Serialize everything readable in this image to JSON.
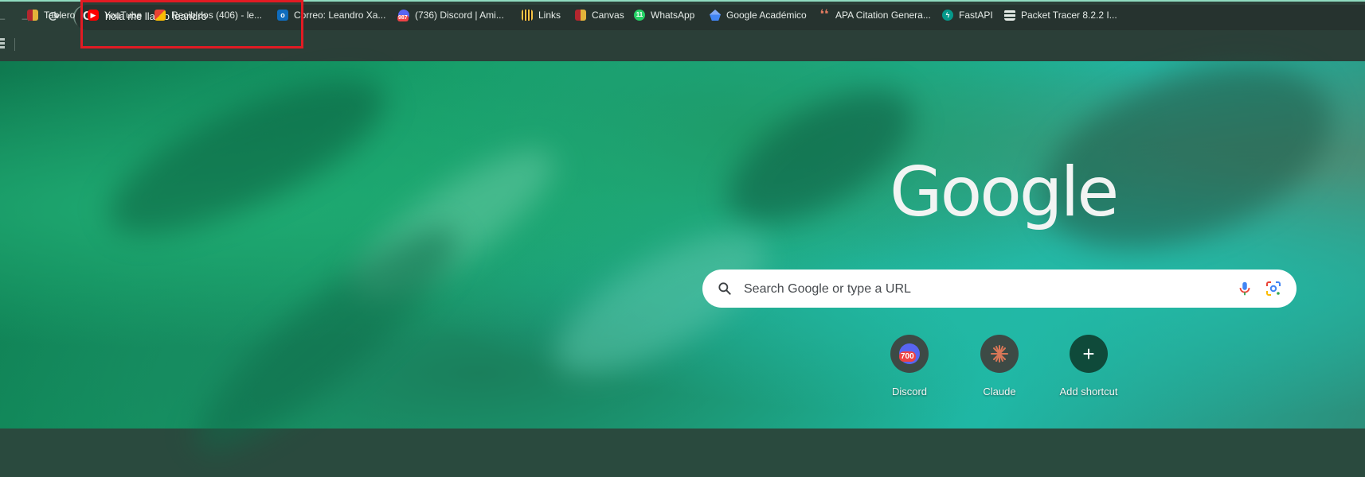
{
  "omnibox": {
    "value": "hola me llamo leandro",
    "engine_icon": "google-g-icon"
  },
  "bookmarks": [
    {
      "label": "Tablero",
      "icon": "tablero-icon",
      "color": "#c9a227"
    },
    {
      "label": "YouTube",
      "icon": "youtube-icon",
      "color": "#ff0000"
    },
    {
      "label": "Recibidos (406) - le...",
      "icon": "gmail-icon",
      "color": "#ea4335"
    },
    {
      "label": "Correo: Leandro Xa...",
      "icon": "outlook-icon",
      "color": "#0f6cbd"
    },
    {
      "label": "(736) Discord | Ami...",
      "icon": "discord-icon",
      "badge": "987",
      "color": "#5865f2"
    },
    {
      "label": "Links",
      "icon": "links-icon",
      "color": "#f6c343"
    },
    {
      "label": "Canvas",
      "icon": "canvas-icon",
      "color": "#c9a227"
    },
    {
      "label": "WhatsApp",
      "icon": "whatsapp-icon",
      "badge": "11",
      "color": "#25d366"
    },
    {
      "label": "Google Académico",
      "icon": "scholar-icon",
      "color": "#4285f4"
    },
    {
      "label": "APA Citation Genera...",
      "icon": "apa-quote-icon",
      "color": "#e07a5f"
    },
    {
      "label": "FastAPI",
      "icon": "fastapi-icon",
      "color": "#05998b"
    },
    {
      "label": "Packet Tracer 8.2.2 I...",
      "icon": "packet-tracer-icon",
      "color": "#e6ece8"
    }
  ],
  "ntp": {
    "logo_text": "Google",
    "search_placeholder": "Search Google or type a URL"
  },
  "shortcuts": [
    {
      "label": "Discord",
      "icon": "discord-icon",
      "badge": "700"
    },
    {
      "label": "Claude",
      "icon": "claude-icon"
    },
    {
      "label": "Add shortcut",
      "icon": "plus-icon"
    }
  ]
}
